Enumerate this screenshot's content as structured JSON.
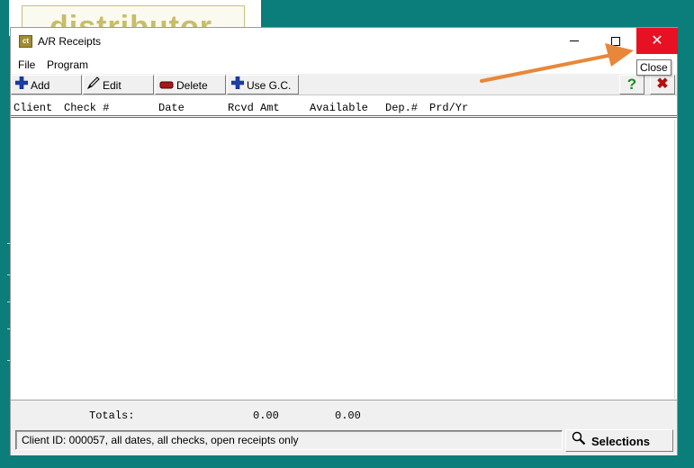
{
  "background_window": {
    "logo_text": "distributor"
  },
  "window": {
    "title": "A/R Receipts",
    "app_icon_text": "ct",
    "controls": {
      "minimize_icon": "minimize-icon",
      "maximize_icon": "maximize-icon",
      "close_glyph": "✕"
    },
    "close_tooltip": "Close"
  },
  "menu": {
    "items": [
      "File",
      "Program"
    ]
  },
  "toolbar": {
    "add_label": "Add",
    "edit_label": "Edit",
    "delete_label": "Delete",
    "use_gc_label": "Use G.C.",
    "help_glyph": "?",
    "exit_glyph": "✖"
  },
  "list": {
    "columns": [
      "Client",
      "Check #",
      "Date",
      "Rcvd Amt",
      "Available",
      "Dep.#",
      "Prd/Yr"
    ],
    "rows": []
  },
  "totals": {
    "label": "Totals:",
    "rcvd_amt": "0.00",
    "available": "0.00"
  },
  "status": {
    "filter_text": "Client ID: 000057, all dates, all checks, open receipts only",
    "selections_label": "Selections"
  },
  "colors": {
    "desktop": "#0b7d7b",
    "close_red": "#e81123",
    "annotation_arrow": "#e8873a",
    "add_icon_blue": "#1a3fa8",
    "help_green": "#1f8a1f",
    "exit_red": "#b01010"
  }
}
